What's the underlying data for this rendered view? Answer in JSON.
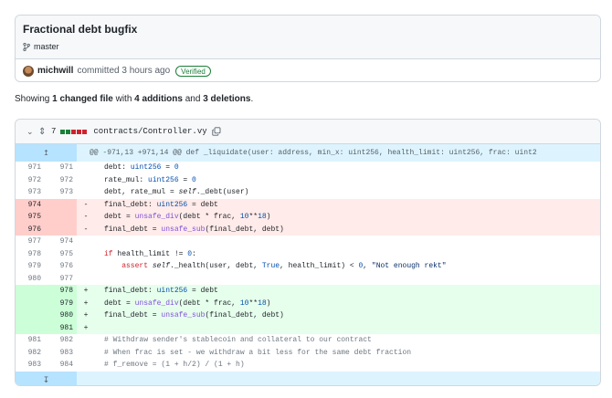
{
  "commit": {
    "title": "Fractional debt bugfix",
    "branch": "master",
    "author": "michwill",
    "committed_text": "committed 3 hours ago",
    "verified_label": "Verified"
  },
  "summary": {
    "prefix": "Showing ",
    "files": "1 changed file",
    "mid1": " with ",
    "additions": "4 additions",
    "mid2": " and ",
    "deletions": "3 deletions",
    "suffix": "."
  },
  "file": {
    "change_count": "7",
    "path": "contracts/Controller.vy",
    "diffstat_colors": [
      "#1a7f37",
      "#1a7f37",
      "#cf222e",
      "#cf222e",
      "#cf222e"
    ],
    "hunk_header": "@@ -971,13 +971,14 @@ def _liquidate(user: address, min_x: uint256, health_limit: uint256, frac: uint2",
    "expand_up_icon": "expand-up-icon",
    "expand_down_icon": "expand-down-icon"
  },
  "lines": [
    {
      "type": "ctx",
      "old": "971",
      "new": "971",
      "sign": "",
      "tokens": [
        [
          "",
          "debt: "
        ],
        [
          "ty",
          "uint256"
        ],
        [
          "",
          " = "
        ],
        [
          "nu",
          "0"
        ]
      ]
    },
    {
      "type": "ctx",
      "old": "972",
      "new": "972",
      "sign": "",
      "tokens": [
        [
          "",
          "rate_mul: "
        ],
        [
          "ty",
          "uint256"
        ],
        [
          "",
          " = "
        ],
        [
          "nu",
          "0"
        ]
      ]
    },
    {
      "type": "ctx",
      "old": "973",
      "new": "973",
      "sign": "",
      "tokens": [
        [
          "",
          "debt, rate_mul = "
        ],
        [
          "self",
          "self"
        ],
        [
          "",
          "._debt(user)"
        ]
      ]
    },
    {
      "type": "del",
      "old": "974",
      "new": "",
      "sign": "-",
      "tokens": [
        [
          "",
          "final_debt: "
        ],
        [
          "ty",
          "uint256"
        ],
        [
          "",
          " = debt"
        ]
      ]
    },
    {
      "type": "del",
      "old": "975",
      "new": "",
      "sign": "-",
      "tokens": [
        [
          "",
          "debt = "
        ],
        [
          "fn",
          "unsafe_div"
        ],
        [
          "",
          "(debt * frac, "
        ],
        [
          "nu",
          "10"
        ],
        [
          "",
          "**"
        ],
        [
          "nu",
          "18"
        ],
        [
          "",
          ")"
        ]
      ]
    },
    {
      "type": "del",
      "old": "976",
      "new": "",
      "sign": "-",
      "tokens": [
        [
          "",
          "final_debt = "
        ],
        [
          "fn",
          "unsafe_sub"
        ],
        [
          "",
          "(final_debt, debt)"
        ]
      ]
    },
    {
      "type": "ctx",
      "old": "977",
      "new": "974",
      "sign": "",
      "tokens": [
        [
          "",
          ""
        ]
      ]
    },
    {
      "type": "ctx",
      "old": "978",
      "new": "975",
      "sign": "",
      "tokens": [
        [
          "kw",
          "if"
        ],
        [
          "",
          " health_limit != "
        ],
        [
          "nu",
          "0"
        ],
        [
          "",
          ":"
        ]
      ]
    },
    {
      "type": "ctx",
      "old": "979",
      "new": "976",
      "sign": "",
      "tokens": [
        [
          "",
          "    "
        ],
        [
          "kw",
          "assert"
        ],
        [
          "",
          " "
        ],
        [
          "self",
          "self"
        ],
        [
          "",
          "._health(user, debt, "
        ],
        [
          "nu",
          "True"
        ],
        [
          "",
          ", health_limit) < "
        ],
        [
          "nu",
          "0"
        ],
        [
          "",
          ", "
        ],
        [
          "st",
          "\"Not enough rekt\""
        ]
      ]
    },
    {
      "type": "ctx",
      "old": "980",
      "new": "977",
      "sign": "",
      "tokens": [
        [
          "",
          ""
        ]
      ]
    },
    {
      "type": "add",
      "old": "",
      "new": "978",
      "sign": "+",
      "tokens": [
        [
          "",
          "final_debt: "
        ],
        [
          "ty",
          "uint256"
        ],
        [
          "",
          " = debt"
        ]
      ]
    },
    {
      "type": "add",
      "old": "",
      "new": "979",
      "sign": "+",
      "tokens": [
        [
          "",
          "debt = "
        ],
        [
          "fn",
          "unsafe_div"
        ],
        [
          "",
          "(debt * frac, "
        ],
        [
          "nu",
          "10"
        ],
        [
          "",
          "**"
        ],
        [
          "nu",
          "18"
        ],
        [
          "",
          ")"
        ]
      ]
    },
    {
      "type": "add",
      "old": "",
      "new": "980",
      "sign": "+",
      "tokens": [
        [
          "",
          "final_debt = "
        ],
        [
          "fn",
          "unsafe_sub"
        ],
        [
          "",
          "(final_debt, debt)"
        ]
      ]
    },
    {
      "type": "add",
      "old": "",
      "new": "981",
      "sign": "+",
      "tokens": [
        [
          "",
          ""
        ]
      ]
    },
    {
      "type": "ctx",
      "old": "981",
      "new": "982",
      "sign": "",
      "tokens": [
        [
          "cm",
          "# Withdraw sender's stablecoin and collateral to our contract"
        ]
      ]
    },
    {
      "type": "ctx",
      "old": "982",
      "new": "983",
      "sign": "",
      "tokens": [
        [
          "cm",
          "# When frac is set - we withdraw a bit less for the same debt fraction"
        ]
      ]
    },
    {
      "type": "ctx",
      "old": "983",
      "new": "984",
      "sign": "",
      "tokens": [
        [
          "cm",
          "# f_remove = (1 + h/2) / (1 + h)"
        ]
      ]
    }
  ]
}
